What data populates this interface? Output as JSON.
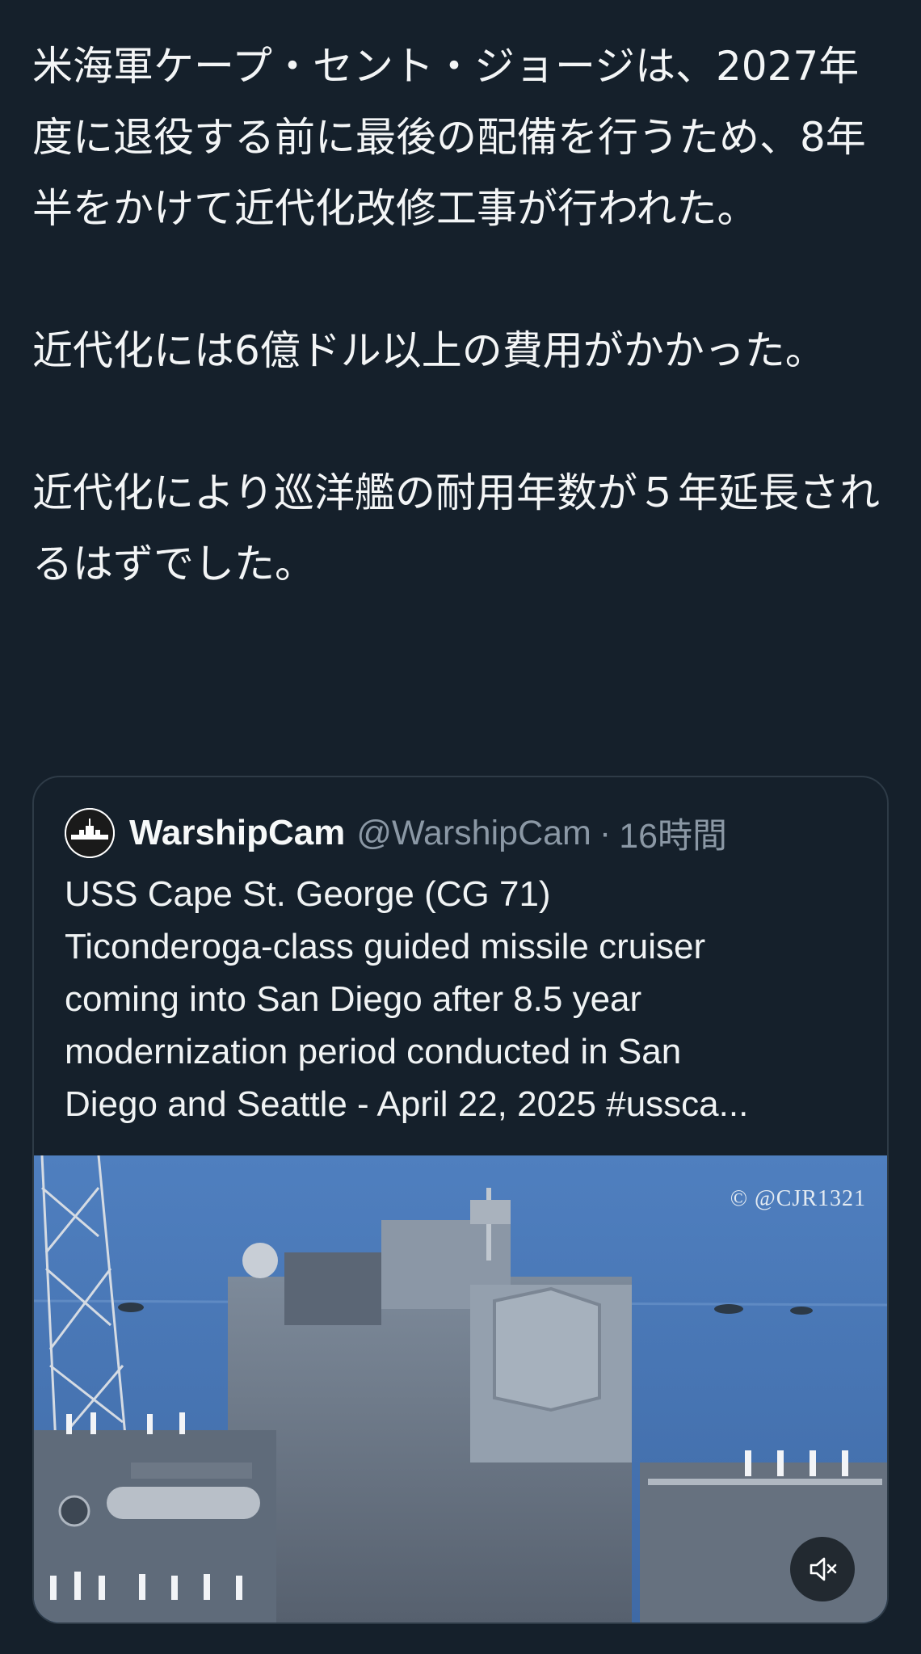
{
  "post": {
    "paragraphs": [
      "米海軍ケープ・セント・ジョージは、2027年度に退役する前に最後の配備を行うため、8年半をかけて近代化改修工事が行われた。",
      "近代化には6億ドル以上の費用がかかった。",
      "近代化により巡洋艦の耐用年数が５年延長されるはずでした。"
    ]
  },
  "quote": {
    "display_name": "WarshipCam",
    "handle": "@WarshipCam",
    "separator": "·",
    "time": "16時間",
    "text_lines": [
      "USS Cape St. George (CG 71)",
      "Ticonderoga-class guided missile cruiser",
      "coming into San Diego after 8.5 year",
      "modernization period conducted in San",
      "Diego and Seattle  - April 22, 2025 #ussca..."
    ],
    "media": {
      "watermark": "© @CJR1321",
      "mute_icon": "speaker-muted-icon"
    }
  },
  "colors": {
    "background": "#15202b",
    "text": "#f7f9f9",
    "secondary_text": "#8b98a5",
    "border": "#2e3b47"
  }
}
